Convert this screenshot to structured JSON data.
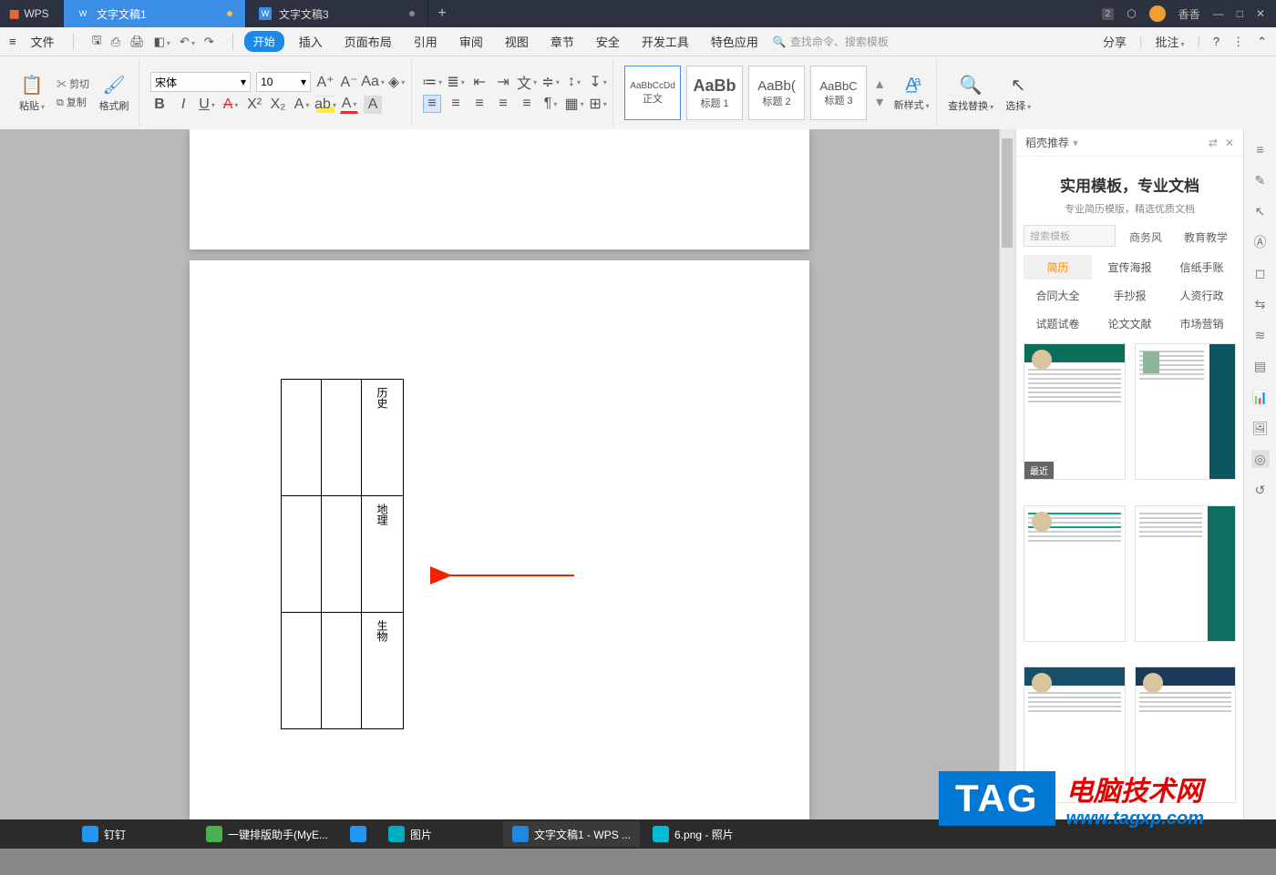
{
  "titlebar": {
    "app": "WPS",
    "tabs": [
      {
        "label": "文字文稿1",
        "active": true,
        "modified": true
      },
      {
        "label": "文字文稿3",
        "active": false,
        "modified": true
      }
    ],
    "badge": "2",
    "user": "香香"
  },
  "menu": {
    "file": "文件",
    "items": [
      "开始",
      "插入",
      "页面布局",
      "引用",
      "审阅",
      "视图",
      "章节",
      "安全",
      "开发工具",
      "特色应用"
    ],
    "active": "开始",
    "search_placeholder": "查找命令、搜索模板",
    "share": "分享",
    "comment": "批注"
  },
  "ribbon": {
    "clipboard": {
      "paste": "粘贴",
      "cut": "剪切",
      "copy": "复制",
      "brush": "格式刷"
    },
    "font": {
      "name": "宋体",
      "size": "10"
    },
    "styles": [
      {
        "preview": "AaBbCcDd",
        "name": "正文"
      },
      {
        "preview": "AaBb",
        "name": "标题 1"
      },
      {
        "preview": "AaBb(",
        "name": "标题 2"
      },
      {
        "preview": "AaBbC",
        "name": "标题 3"
      }
    ],
    "newstyle": "新样式",
    "findreplace": "查找替换",
    "select": "选择"
  },
  "document": {
    "table_rows": [
      "历史",
      "地理",
      "生物"
    ]
  },
  "side_panel": {
    "title": "稻壳推荐",
    "promo_title": "实用模板，专业文档",
    "promo_sub": "专业简历模版，精选优质文档",
    "search_placeholder": "搜索模板",
    "top_tabs": [
      "商务风",
      "教育教学"
    ],
    "categories": [
      "简历",
      "宣传海报",
      "信纸手账",
      "合同大全",
      "手抄报",
      "人资行政",
      "试题试卷",
      "论文文献",
      "市场营销"
    ],
    "category_selected": "简历",
    "recent_label": "最近"
  },
  "taskbar": {
    "items": [
      {
        "label": "钉钉",
        "color": "#2196f3"
      },
      {
        "label": "一键排版助手(MyE...",
        "color": "#4caf50"
      },
      {
        "label": "",
        "color": "#2196f3"
      },
      {
        "label": "图片",
        "color": "#00acc1"
      },
      {
        "label": "文字文稿1 - WPS ...",
        "color": "#1e88e5",
        "active": true
      },
      {
        "label": "6.png - 照片",
        "color": "#00bcd4"
      }
    ]
  },
  "watermark": {
    "tag": "TAG",
    "line1": "电脑技术网",
    "line2": "www.tagxp.com"
  }
}
